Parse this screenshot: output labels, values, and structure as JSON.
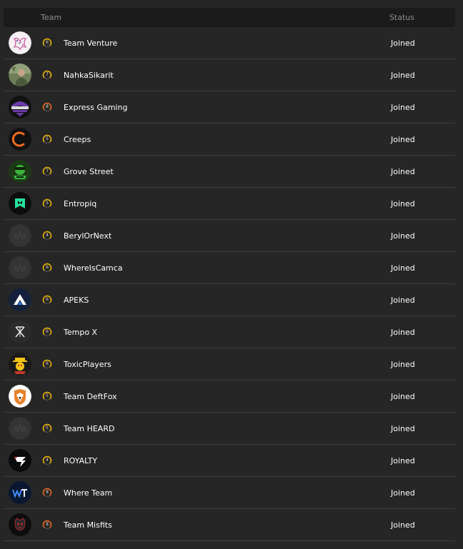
{
  "header": {
    "team": "Team",
    "status": "Status"
  },
  "colors": {
    "level_yellow": "#f2b705",
    "level_orange": "#f36b21",
    "row_divider": "#3d3d3d",
    "header_bg": "#1b1b1b",
    "page_bg": "#262626"
  },
  "rows": [
    {
      "name": "Team Venture",
      "level": "6",
      "level_color": "yellow",
      "status": "Joined",
      "avatar": "team-venture-logo"
    },
    {
      "name": "NahkaSikarit",
      "level": "7",
      "level_color": "yellow",
      "status": "Joined",
      "avatar": "nahkasikarit-photo"
    },
    {
      "name": "Express Gaming",
      "level": "8",
      "level_color": "orange",
      "status": "Joined",
      "avatar": "express-gaming-logo"
    },
    {
      "name": "Creeps",
      "level": "5",
      "level_color": "yellow",
      "status": "Joined",
      "avatar": "creeps-logo"
    },
    {
      "name": "Grove Street",
      "level": "7",
      "level_color": "yellow",
      "status": "Joined",
      "avatar": "grove-street-logo"
    },
    {
      "name": "Entropiq",
      "level": "5",
      "level_color": "yellow",
      "status": "Joined",
      "avatar": "entropiq-logo"
    },
    {
      "name": "BerylOrNext",
      "level": "4",
      "level_color": "yellow",
      "status": "Joined",
      "avatar": "default-team-logo"
    },
    {
      "name": "WhereIsCamca",
      "level": "6",
      "level_color": "yellow",
      "status": "Joined",
      "avatar": "default-team-logo"
    },
    {
      "name": "APEKS",
      "level": "6",
      "level_color": "yellow",
      "status": "Joined",
      "avatar": "apeks-logo"
    },
    {
      "name": "Tempo X",
      "level": "6",
      "level_color": "yellow",
      "status": "Joined",
      "avatar": "tempo-x-logo"
    },
    {
      "name": "ToxicPlayers",
      "level": "6",
      "level_color": "yellow",
      "status": "Joined",
      "avatar": "toxicplayers-logo"
    },
    {
      "name": "Team DeftFox",
      "level": "5",
      "level_color": "yellow",
      "status": "Joined",
      "avatar": "team-deftfox-logo"
    },
    {
      "name": "Team HEARD",
      "level": "5",
      "level_color": "yellow",
      "status": "Joined",
      "avatar": "default-team-logo"
    },
    {
      "name": "ROYALTY",
      "level": "4",
      "level_color": "yellow",
      "status": "Joined",
      "avatar": "royalty-logo"
    },
    {
      "name": "Where Team",
      "level": "8",
      "level_color": "orange",
      "status": "Joined",
      "avatar": "where-team-logo"
    },
    {
      "name": "Team Misfits",
      "level": "8",
      "level_color": "orange",
      "status": "Joined",
      "avatar": "team-misfits-logo"
    }
  ]
}
